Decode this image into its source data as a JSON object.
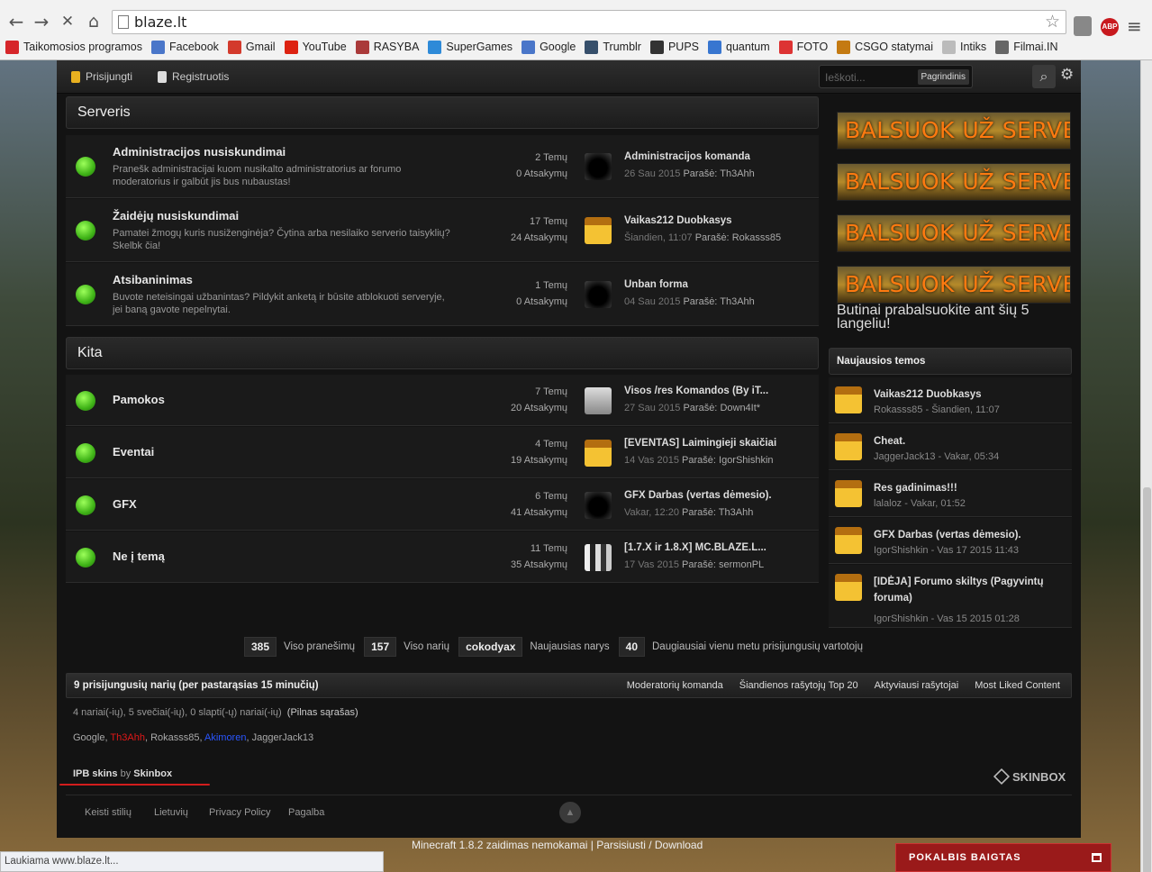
{
  "browser": {
    "url": "blaze.lt",
    "bookmarks": [
      {
        "label": "Taikomosios programos",
        "color": "#d6262a"
      },
      {
        "label": "Facebook",
        "color": "#4a76c9"
      },
      {
        "label": "Gmail",
        "color": "#d33a2c"
      },
      {
        "label": "YouTube",
        "color": "#d21"
      },
      {
        "label": "RASYBA",
        "color": "#aa3a3a"
      },
      {
        "label": "SuperGames",
        "color": "#2e8ad8"
      },
      {
        "label": "Google",
        "color": "#4a76c9"
      },
      {
        "label": "Trumblr",
        "color": "#364f6b"
      },
      {
        "label": "PUPS",
        "color": "#333"
      },
      {
        "label": "quantum",
        "color": "#3876d0"
      },
      {
        "label": "FOTO",
        "color": "#d33"
      },
      {
        "label": "CSGO statymai",
        "color": "#c47a12"
      },
      {
        "label": "Intiks",
        "color": "#bbb"
      },
      {
        "label": "Filmai.IN",
        "color": "#666"
      }
    ],
    "status": "Laukiama www.blaze.lt..."
  },
  "userbar": {
    "login": "Prisijungti",
    "register": "Registruotis",
    "search_placeholder": "Ieškoti...",
    "search_scope": "Pagrindinis"
  },
  "categories": [
    {
      "title": "Serveris",
      "forums": [
        {
          "title": "Administracijos nusiskundimai",
          "desc": "Pranešk administracijai kuom nusikalto administratorius ar forumo moderatorius ir galbūt jis bus nubaustas!",
          "topics": "2 Temų",
          "replies": "0 Atsakymų",
          "last_title": "Administracijos komanda",
          "last_date": "26 Sau 2015",
          "last_by_label": "Parašė:",
          "last_by": "Th3Ahh",
          "av": "dark"
        },
        {
          "title": "Žaidėjų nusiskundimai",
          "desc": "Pamatei žmogų kuris nusiženginėja? Čytina arba nesilaiko serverio taisyklių? Skelbk čia!",
          "topics": "17 Temų",
          "replies": "24 Atsakymų",
          "last_title": "Vaikas212 Duobkasys",
          "last_date": "Šiandien, 11:07",
          "last_by_label": "Parašė:",
          "last_by": "Rokasss85",
          "av": "yellow"
        },
        {
          "title": "Atsibaninimas",
          "desc": "Buvote neteisingai užbanintas? Pildykit anketą ir būsite atblokuoti serveryje, jei baną gavote nepelnytai.",
          "topics": "1 Temų",
          "replies": "0 Atsakymų",
          "last_title": "Unban forma",
          "last_date": "04 Sau 2015",
          "last_by_label": "Parašė:",
          "last_by": "Th3Ahh",
          "av": "dark"
        }
      ]
    },
    {
      "title": "Kita",
      "forums": [
        {
          "title": "Pamokos",
          "desc": "",
          "topics": "7 Temų",
          "replies": "20 Atsakymų",
          "last_title": "Visos /res Komandos (By iT...",
          "last_date": "27 Sau 2015",
          "last_by_label": "Parašė:",
          "last_by": "Down4It*",
          "av": "gray"
        },
        {
          "title": "Eventai",
          "desc": "",
          "topics": "4 Temų",
          "replies": "19 Atsakymų",
          "last_title": "[EVENTAS] Laimingieji skaičiai",
          "last_date": "14 Vas 2015",
          "last_by_label": "Parašė:",
          "last_by": "IgorShishkin",
          "av": "yellow"
        },
        {
          "title": "GFX",
          "desc": "",
          "topics": "6 Temų",
          "replies": "41 Atsakymų",
          "last_title": "GFX Darbas (vertas dėmesio).",
          "last_date": "Vakar, 12:20",
          "last_by_label": "Parašė:",
          "last_by": "Th3Ahh",
          "av": "dark"
        },
        {
          "title": "Ne į temą",
          "desc": "",
          "topics": "11 Temų",
          "replies": "35 Atsakymų",
          "last_title": "[1.7.X ir 1.8.X] MC.BLAZE.L...",
          "last_date": "17 Vas 2015",
          "last_by_label": "Parašė:",
          "last_by": "sermonPL",
          "av": "bw"
        }
      ]
    }
  ],
  "sidebar": {
    "vote_label": "BALSUOK UŽ SERVERĮ!",
    "vote_note": "Butinai prabalsuokite ant šių 5 langeliu!",
    "newest_header": "Naujausios temos",
    "newest": [
      {
        "title": "Vaikas212 Duobkasys",
        "meta": "Rokasss85 - Šiandien, 11:07"
      },
      {
        "title": "Cheat.",
        "meta": "JaggerJack13 - Vakar, 05:34"
      },
      {
        "title": "Res gadinimas!!!",
        "meta": "lalaloz - Vakar, 01:52"
      },
      {
        "title": "GFX Darbas (vertas dėmesio).",
        "meta": "IgorShishkin - Vas 17 2015 11:43"
      },
      {
        "title": "[IDĖJA] Forumo skiltys (Pagyvintų foruma)",
        "meta": "IgorShishkin - Vas 15 2015 01:28"
      }
    ]
  },
  "stats": {
    "posts_num": "385",
    "posts_label": "Viso pranešimų",
    "members_num": "157",
    "members_label": "Viso narių",
    "newest_member": "cokodyax",
    "newest_label": "Naujausias narys",
    "max_num": "40",
    "max_label": "Daugiausiai vienu metu prisijungusių vartotojų"
  },
  "online": {
    "title": "9 prisijungusių narių (per pastarąsias 15 minučių)",
    "links": [
      "Moderatorių komanda",
      "Šiandienos rašytojų Top 20",
      "Aktyviausi rašytojai",
      "Most Liked Content"
    ],
    "summary": "4 nariai(-ių), 5 svečiai(-ių), 0 slapti(-ų) nariai(-ių)",
    "full_list": "(Pilnas sąrašas)",
    "users": [
      {
        "name": "Google",
        "color": "#aaa"
      },
      {
        "name": "Th3Ahh",
        "color": "#e01818"
      },
      {
        "name": "Rokasss85",
        "color": "#aaa"
      },
      {
        "name": "Akimoren",
        "color": "#2a56ff"
      },
      {
        "name": "JaggerJack13",
        "color": "#aaa"
      }
    ]
  },
  "footer": {
    "ipb_skins": "IPB skins",
    "by": "by",
    "skinbox": "Skinbox",
    "skinbox_logo": "SKINBOX",
    "links": [
      "Keisti stilių",
      "Lietuvių",
      "Privacy Policy",
      "Pagalba"
    ],
    "bottom_text": "Minecraft 1.8.2 zaidimas nemokamai | Parsisiusti / Download"
  },
  "chat": {
    "label": "POKALBIS BAIGTAS"
  }
}
